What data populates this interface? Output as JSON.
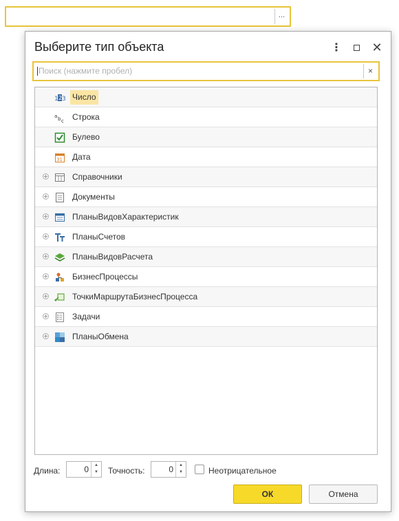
{
  "top_field": {
    "value": "",
    "pick_label": "..."
  },
  "dialog": {
    "title": "Выберите тип объекта",
    "more_label": "⋮",
    "close_label": "✕",
    "search": {
      "placeholder": "Поиск (нажмите пробел)",
      "clear_label": "×"
    },
    "rows": [
      {
        "label": "Число",
        "icon": "number-icon",
        "expandable": false,
        "selected": true
      },
      {
        "label": "Строка",
        "icon": "string-icon",
        "expandable": false,
        "selected": false
      },
      {
        "label": "Булево",
        "icon": "boolean-icon",
        "expandable": false,
        "selected": false
      },
      {
        "label": "Дата",
        "icon": "date-icon",
        "expandable": false,
        "selected": false
      },
      {
        "label": "Справочники",
        "icon": "catalog-icon",
        "expandable": true,
        "selected": false
      },
      {
        "label": "Документы",
        "icon": "document-icon",
        "expandable": true,
        "selected": false
      },
      {
        "label": "ПланыВидовХарактеристик",
        "icon": "characteristic-types-icon",
        "expandable": true,
        "selected": false
      },
      {
        "label": "ПланыСчетов",
        "icon": "chart-of-accounts-icon",
        "expandable": true,
        "selected": false
      },
      {
        "label": "ПланыВидовРасчета",
        "icon": "calculation-types-icon",
        "expandable": true,
        "selected": false
      },
      {
        "label": "БизнесПроцессы",
        "icon": "business-process-icon",
        "expandable": true,
        "selected": false
      },
      {
        "label": "ТочкиМаршрутаБизнесПроцесса",
        "icon": "route-point-icon",
        "expandable": true,
        "selected": false
      },
      {
        "label": "Задачи",
        "icon": "task-icon",
        "expandable": true,
        "selected": false
      },
      {
        "label": "ПланыОбмена",
        "icon": "exchange-plan-icon",
        "expandable": true,
        "selected": false
      }
    ],
    "length": {
      "label": "Длина:",
      "value": "0"
    },
    "precision": {
      "label": "Точность:",
      "value": "0"
    },
    "nonnegative": {
      "label": "Неотрицательное",
      "checked": false
    },
    "ok_label": "ОК",
    "cancel_label": "Отмена"
  },
  "colors": {
    "accent": "#f7d92a",
    "focus_border": "#e8c43a",
    "selection": "#fbe5a4"
  }
}
